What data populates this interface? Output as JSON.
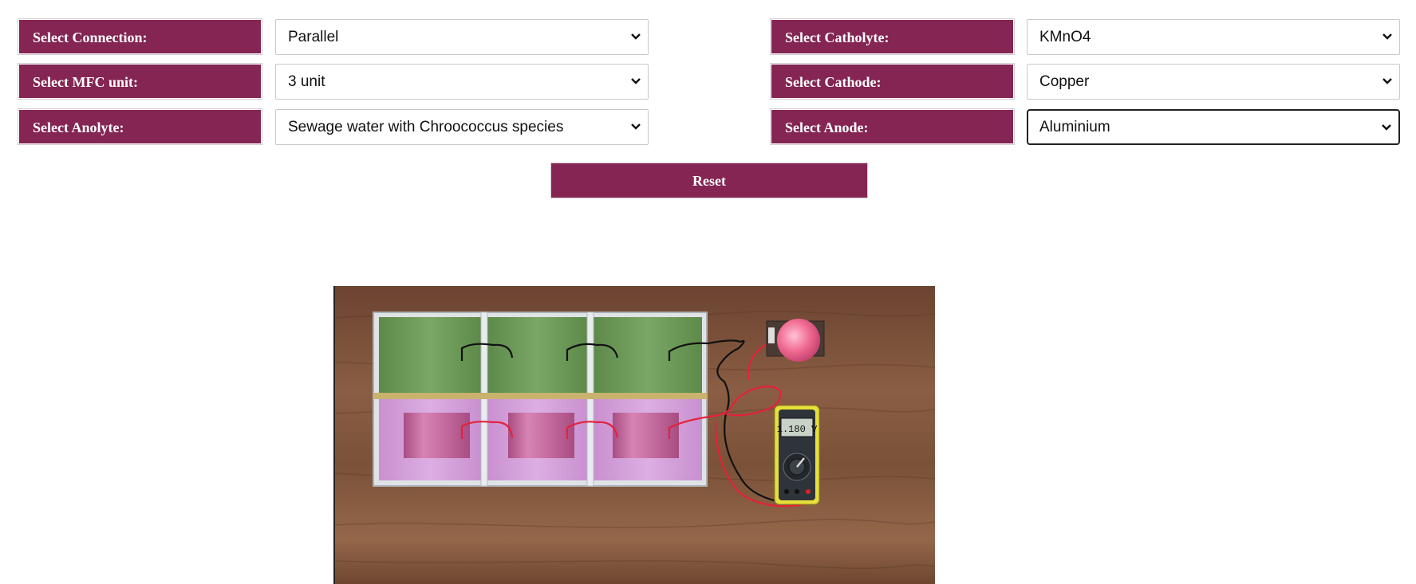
{
  "controls": {
    "connection": {
      "label": "Select Connection:",
      "value": "Parallel"
    },
    "mfc_unit": {
      "label": "Select MFC unit:",
      "value": "3 unit"
    },
    "anolyte": {
      "label": "Select Anolyte:",
      "value": "Sewage water with Chroococcus species"
    },
    "catholyte": {
      "label": "Select Catholyte:",
      "value": "KMnO4"
    },
    "cathode": {
      "label": "Select Cathode:",
      "value": "Copper"
    },
    "anode": {
      "label": "Select Anode:",
      "value": "Aluminium"
    }
  },
  "reset_label": "Reset",
  "multimeter": {
    "reading": "1.180 V"
  },
  "colors": {
    "accent": "#842553",
    "catholyte_fill": "#6f9a58",
    "anolyte_fill": "#d7a2dc",
    "electrode": "#c9699f",
    "table_wood": "#7a5238",
    "bulb": "#f06a92",
    "multimeter_body": "#e8e03a"
  }
}
